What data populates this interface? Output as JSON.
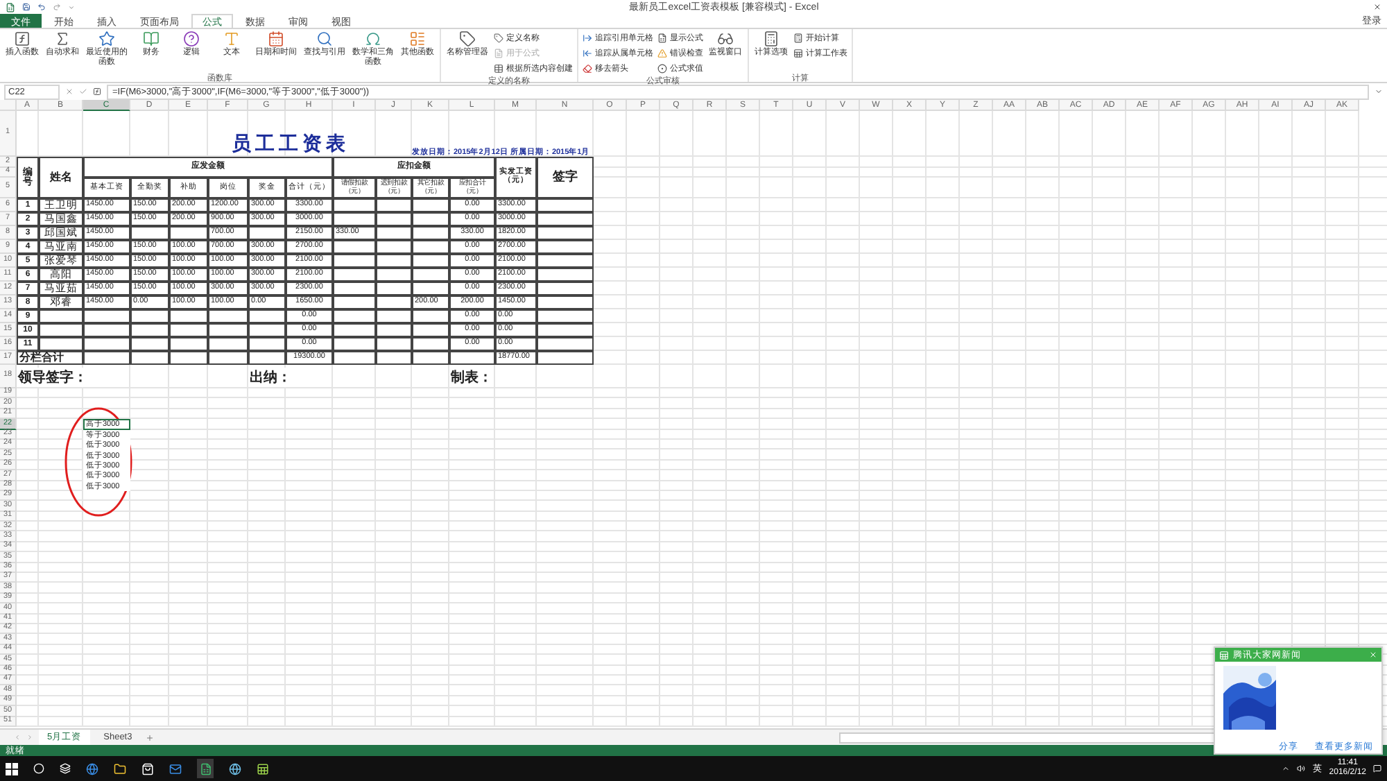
{
  "window": {
    "title": "最新员工excel工资表模板 [兼容模式] - Excel",
    "account": "登录"
  },
  "ribbon_tabs": [
    {
      "label": "文件",
      "kind": "file",
      "selected": false
    },
    {
      "label": "开始",
      "kind": "tab",
      "selected": false
    },
    {
      "label": "插入",
      "kind": "tab",
      "selected": false
    },
    {
      "label": "页面布局",
      "kind": "tab",
      "selected": false
    },
    {
      "label": "公式",
      "kind": "tab",
      "selected": true
    },
    {
      "label": "数据",
      "kind": "tab",
      "selected": false
    },
    {
      "label": "审阅",
      "kind": "tab",
      "selected": false
    },
    {
      "label": "视图",
      "kind": "tab",
      "selected": false
    }
  ],
  "ribbon_groups": [
    {
      "label": "函数库",
      "items": [
        {
          "label": "插入函数",
          "kind": "large",
          "disabled": false
        },
        {
          "label": "自动求和",
          "kind": "large",
          "disabled": false
        },
        {
          "label": "最近使用的函数",
          "kind": "large",
          "disabled": false
        },
        {
          "label": "财务",
          "kind": "large",
          "disabled": false
        },
        {
          "label": "逻辑",
          "kind": "large",
          "disabled": false
        },
        {
          "label": "文本",
          "kind": "large",
          "disabled": false
        },
        {
          "label": "日期和时间",
          "kind": "large",
          "disabled": false
        },
        {
          "label": "查找与引用",
          "kind": "large",
          "disabled": false
        },
        {
          "label": "数学和三角函数",
          "kind": "large",
          "disabled": false
        },
        {
          "label": "其他函数",
          "kind": "large",
          "disabled": false
        }
      ]
    },
    {
      "label": "定义的名称",
      "items": [
        {
          "label": "名称管理器",
          "kind": "large",
          "disabled": false
        },
        {
          "label": "定义名称",
          "kind": "small",
          "disabled": false
        },
        {
          "label": "用于公式",
          "kind": "small",
          "disabled": true
        },
        {
          "label": "根据所选内容创建",
          "kind": "small",
          "disabled": false
        }
      ]
    },
    {
      "label": "公式审核",
      "items": [
        {
          "label": "追踪引用单元格",
          "kind": "small",
          "disabled": false
        },
        {
          "label": "追踪从属单元格",
          "kind": "small",
          "disabled": false
        },
        {
          "label": "移去箭头",
          "kind": "small",
          "disabled": false
        },
        {
          "label": "显示公式",
          "kind": "small",
          "disabled": false
        },
        {
          "label": "错误检查",
          "kind": "small",
          "disabled": false
        },
        {
          "label": "公式求值",
          "kind": "small",
          "disabled": false
        },
        {
          "label": "监视窗口",
          "kind": "large",
          "disabled": false
        }
      ]
    },
    {
      "label": "计算",
      "items": [
        {
          "label": "计算选项",
          "kind": "large",
          "disabled": false
        },
        {
          "label": "开始计算",
          "kind": "small",
          "disabled": false
        },
        {
          "label": "计算工作表",
          "kind": "small",
          "disabled": false
        }
      ]
    }
  ],
  "formula_bar": {
    "name_box": "C22",
    "formula": "=IF(M6>3000,\"高于3000\",IF(M6=3000,\"等于3000\",\"低于3000\"))"
  },
  "columns": [
    {
      "label": "A",
      "selected": false
    },
    {
      "label": "B",
      "selected": false
    },
    {
      "label": "C",
      "selected": true
    },
    {
      "label": "D",
      "selected": false
    },
    {
      "label": "E",
      "selected": false
    },
    {
      "label": "F",
      "selected": false
    },
    {
      "label": "G",
      "selected": false
    },
    {
      "label": "H",
      "selected": false
    },
    {
      "label": "I",
      "selected": false
    },
    {
      "label": "J",
      "selected": false
    },
    {
      "label": "K",
      "selected": false
    },
    {
      "label": "L",
      "selected": false
    },
    {
      "label": "M",
      "selected": false
    },
    {
      "label": "N",
      "selected": false
    },
    {
      "label": "O",
      "selected": false
    },
    {
      "label": "P",
      "selected": false
    },
    {
      "label": "Q",
      "selected": false
    },
    {
      "label": "R",
      "selected": false
    },
    {
      "label": "S",
      "selected": false
    },
    {
      "label": "T",
      "selected": false
    },
    {
      "label": "U",
      "selected": false
    },
    {
      "label": "V",
      "selected": false
    },
    {
      "label": "W",
      "selected": false
    },
    {
      "label": "X",
      "selected": false
    },
    {
      "label": "Y",
      "selected": false
    },
    {
      "label": "Z",
      "selected": false
    },
    {
      "label": "AA",
      "selected": false
    },
    {
      "label": "AB",
      "selected": false
    },
    {
      "label": "AC",
      "selected": false
    },
    {
      "label": "AD",
      "selected": false
    },
    {
      "label": "AE",
      "selected": false
    },
    {
      "label": "AF",
      "selected": false
    },
    {
      "label": "AG",
      "selected": false
    },
    {
      "label": "AH",
      "selected": false
    },
    {
      "label": "AI",
      "selected": false
    },
    {
      "label": "AJ",
      "selected": false
    },
    {
      "label": "AK",
      "selected": false
    }
  ],
  "row_numbers": [
    {
      "label": "1",
      "selected": false
    },
    {
      "label": "2",
      "selected": false
    },
    {
      "label": "4",
      "selected": false
    },
    {
      "label": "5",
      "selected": false
    },
    {
      "label": "6",
      "selected": false
    },
    {
      "label": "7",
      "selected": false
    },
    {
      "label": "8",
      "selected": false
    },
    {
      "label": "9",
      "selected": false
    },
    {
      "label": "10",
      "selected": false
    },
    {
      "label": "11",
      "selected": false
    },
    {
      "label": "12",
      "selected": false
    },
    {
      "label": "13",
      "selected": false
    },
    {
      "label": "14",
      "selected": false
    },
    {
      "label": "15",
      "selected": false
    },
    {
      "label": "16",
      "selected": false
    },
    {
      "label": "17",
      "selected": false
    },
    {
      "label": "18",
      "selected": false
    },
    {
      "label": "19",
      "selected": false
    },
    {
      "label": "20",
      "selected": false
    },
    {
      "label": "21",
      "selected": false
    },
    {
      "label": "22",
      "selected": true
    },
    {
      "label": "23",
      "selected": false
    },
    {
      "label": "24",
      "selected": false
    },
    {
      "label": "25",
      "selected": false
    },
    {
      "label": "26",
      "selected": false
    },
    {
      "label": "27",
      "selected": false
    },
    {
      "label": "28",
      "selected": false
    },
    {
      "label": "29",
      "selected": false
    },
    {
      "label": "30",
      "selected": false
    },
    {
      "label": "31",
      "selected": false
    },
    {
      "label": "32",
      "selected": false
    },
    {
      "label": "33",
      "selected": false
    },
    {
      "label": "34",
      "selected": false
    },
    {
      "label": "35",
      "selected": false
    },
    {
      "label": "36",
      "selected": false
    },
    {
      "label": "37",
      "selected": false
    },
    {
      "label": "38",
      "selected": false
    },
    {
      "label": "39",
      "selected": false
    },
    {
      "label": "40",
      "selected": false
    },
    {
      "label": "41",
      "selected": false
    },
    {
      "label": "42",
      "selected": false
    },
    {
      "label": "43",
      "selected": false
    },
    {
      "label": "44",
      "selected": false
    },
    {
      "label": "45",
      "selected": false
    },
    {
      "label": "46",
      "selected": false
    },
    {
      "label": "47",
      "selected": false
    },
    {
      "label": "48",
      "selected": false
    },
    {
      "label": "49",
      "selected": false
    },
    {
      "label": "50",
      "selected": false
    },
    {
      "label": "51",
      "selected": false
    }
  ],
  "sheet": {
    "title": "员工工资表",
    "dates": "发放日期：2015年2月12日  所属日期：2015年1月",
    "header": {
      "number": "编号",
      "name": "姓名",
      "earnings": "应发金额",
      "earning_columns": [
        "基本工资",
        "全勤奖",
        "补助",
        "岗位",
        "奖金",
        "合计（元）"
      ],
      "deductions": "应扣金额",
      "deduction_columns": [
        "请假扣款（元）",
        "迟到扣款（元）",
        "其它扣款（元）",
        "应扣合计（元）"
      ],
      "net": "实发工资（元）",
      "signature": "签字"
    },
    "rows": [
      {
        "no": "1",
        "name": "王卫明",
        "values": {
          "basic": "1450.00",
          "attendance": "150.00",
          "allowance": "200.00",
          "post": "1200.00",
          "bonus": "300.00",
          "earn_total": "3300.00",
          "deduct_total": "0.00",
          "net": "3300.00"
        }
      },
      {
        "no": "2",
        "name": "马国鑫",
        "values": {
          "basic": "1450.00",
          "attendance": "150.00",
          "allowance": "200.00",
          "post": "900.00",
          "bonus": "300.00",
          "earn_total": "3000.00",
          "deduct_total": "0.00",
          "net": "3000.00"
        }
      },
      {
        "no": "3",
        "name": "邱国斌",
        "values": {
          "basic": "1450.00",
          "post": "700.00",
          "earn_total": "2150.00",
          "leave": "330.00",
          "deduct_total": "330.00",
          "net": "1820.00"
        }
      },
      {
        "no": "4",
        "name": "马亚南",
        "values": {
          "basic": "1450.00",
          "attendance": "150.00",
          "allowance": "100.00",
          "post": "700.00",
          "bonus": "300.00",
          "earn_total": "2700.00",
          "deduct_total": "0.00",
          "net": "2700.00"
        }
      },
      {
        "no": "5",
        "name": "张爱琴",
        "values": {
          "basic": "1450.00",
          "attendance": "150.00",
          "allowance": "100.00",
          "post": "100.00",
          "bonus": "300.00",
          "earn_total": "2100.00",
          "deduct_total": "0.00",
          "net": "2100.00"
        }
      },
      {
        "no": "6",
        "name": "高阳",
        "values": {
          "basic": "1450.00",
          "attendance": "150.00",
          "allowance": "100.00",
          "post": "100.00",
          "bonus": "300.00",
          "earn_total": "2100.00",
          "deduct_total": "0.00",
          "net": "2100.00"
        }
      },
      {
        "no": "7",
        "name": "马亚茹",
        "values": {
          "basic": "1450.00",
          "attendance": "150.00",
          "allowance": "100.00",
          "post": "300.00",
          "bonus": "300.00",
          "earn_total": "2300.00",
          "deduct_total": "0.00",
          "net": "2300.00"
        }
      },
      {
        "no": "8",
        "name": "邓睿",
        "values": {
          "basic": "1450.00",
          "attendance": "0.00",
          "allowance": "100.00",
          "post": "100.00",
          "bonus": "0.00",
          "earn_total": "1650.00",
          "other": "200.00",
          "deduct_total": "200.00",
          "net": "1450.00"
        }
      },
      {
        "no": "9",
        "values": {
          "earn_total": "0.00",
          "deduct_total": "0.00",
          "net": "0.00"
        }
      },
      {
        "no": "10",
        "values": {
          "earn_total": "0.00",
          "deduct_total": "0.00",
          "net": "0.00"
        }
      },
      {
        "no": "11",
        "values": {
          "earn_total": "0.00",
          "deduct_total": "0.00",
          "net": "0.00"
        }
      }
    ],
    "total": {
      "label": "分栏合计",
      "values": {
        "earn_total": "19300.00",
        "net": "18770.00"
      }
    },
    "signatures": [
      "领导签字：",
      "出纳：",
      "制表："
    ],
    "results": [
      {
        "text": "高于3000",
        "selected": true
      },
      {
        "text": "等于3000",
        "selected": false
      },
      {
        "text": "低于3000",
        "selected": false
      },
      {
        "text": "低于3000",
        "selected": false
      },
      {
        "text": "低于3000",
        "selected": false
      },
      {
        "text": "低于3000",
        "selected": false
      },
      {
        "text": "低于3000",
        "selected": false
      }
    ]
  },
  "sheet_tabs": [
    {
      "label": "5月工资",
      "selected": true
    },
    {
      "label": "Sheet3",
      "selected": false
    }
  ],
  "status_bar": {
    "text": "就绪"
  },
  "notification": {
    "title": "腾讯大家网新闻",
    "links": [
      "分享",
      "查看更多新闻"
    ]
  },
  "taskbar": {
    "ime": "英",
    "time": "11:41",
    "date": "2016/2/12"
  }
}
